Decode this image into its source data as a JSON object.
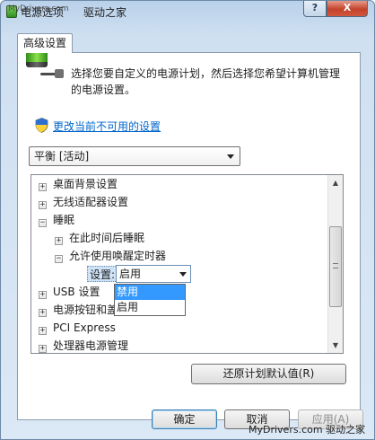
{
  "window": {
    "title": "电源选项",
    "brand": "驱动之家",
    "watermark_top": "MyDrivers.com",
    "help_label": "?",
    "close_label": "X"
  },
  "tab": {
    "label": "高级设置"
  },
  "intro": {
    "text": "选择您要自定义的电源计划，然后选择您希望计算机管理的电源设置。"
  },
  "change_link": {
    "label": "更改当前不可用的设置"
  },
  "plan_select": {
    "value": "平衡 [活动]"
  },
  "tree": {
    "items": [
      {
        "label": "桌面背景设置",
        "expander": "+"
      },
      {
        "label": "无线适配器设置",
        "expander": "+"
      },
      {
        "label": "睡眠",
        "expander": "−"
      },
      {
        "label": "在此时间后睡眠",
        "expander": "+"
      },
      {
        "label": "允许使用唤醒定时器",
        "expander": "−"
      },
      {
        "label": "USB 设置",
        "expander": "+"
      },
      {
        "label": "电源按钮和盖",
        "expander": "+"
      },
      {
        "label": "PCI Express",
        "expander": "+"
      },
      {
        "label": "处理器电源管理",
        "expander": "+"
      }
    ],
    "setting": {
      "label": "设置:",
      "value": "启用",
      "options": [
        "禁用",
        "启用"
      ],
      "highlighted": "禁用"
    },
    "scroll_up": "▲",
    "scroll_down": "▼"
  },
  "restore_button": {
    "label": "还原计划默认值(R)"
  },
  "buttons": {
    "ok": "确定",
    "cancel": "取消",
    "apply": "应用(A)"
  },
  "footer_watermark": "MyDrivers.com 驱动之家"
}
